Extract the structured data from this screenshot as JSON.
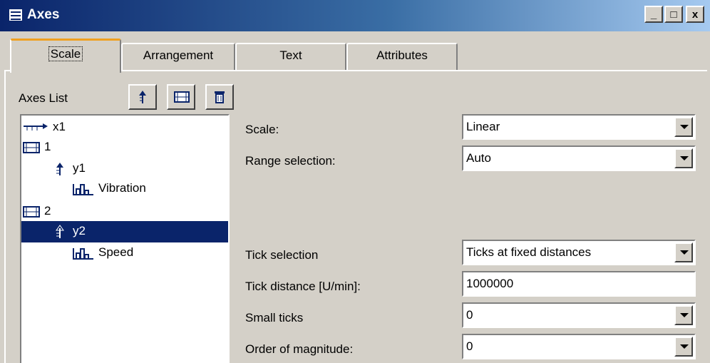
{
  "window": {
    "title": "Axes",
    "minimize": "_",
    "maximize": "□",
    "close": "x"
  },
  "tabs": [
    "Scale",
    "Arrangement",
    "Text",
    "Attributes"
  ],
  "axes_list": {
    "label": "Axes List",
    "tree": [
      {
        "label": "x1",
        "icon": "x-axis-icon"
      },
      {
        "label": "1",
        "icon": "system-icon"
      },
      {
        "label": "y1",
        "icon": "y-axis-icon"
      },
      {
        "label": "Vibration",
        "icon": "channel-icon"
      },
      {
        "label": "2",
        "icon": "system-icon"
      },
      {
        "label": "y2",
        "icon": "y-axis-icon",
        "selected": true
      },
      {
        "label": "Speed",
        "icon": "channel-icon"
      }
    ]
  },
  "settings": {
    "scale_label": "Scale:",
    "scale_value": "Linear",
    "range_label": "Range selection:",
    "range_value": "Auto",
    "tick_selection_label": "Tick selection",
    "tick_selection_value": "Ticks at fixed distances",
    "tick_distance_label": "Tick distance [U/min]:",
    "tick_distance_value": "1000000",
    "small_ticks_label": "Small ticks",
    "small_ticks_value": "0",
    "magnitude_label": "Order of magnitude:",
    "magnitude_value": "0"
  },
  "colors": {
    "titlebar": "#0a246a",
    "selection": "#0a246a",
    "tab_accent": "#f0a020",
    "face": "#d4d0c8"
  }
}
